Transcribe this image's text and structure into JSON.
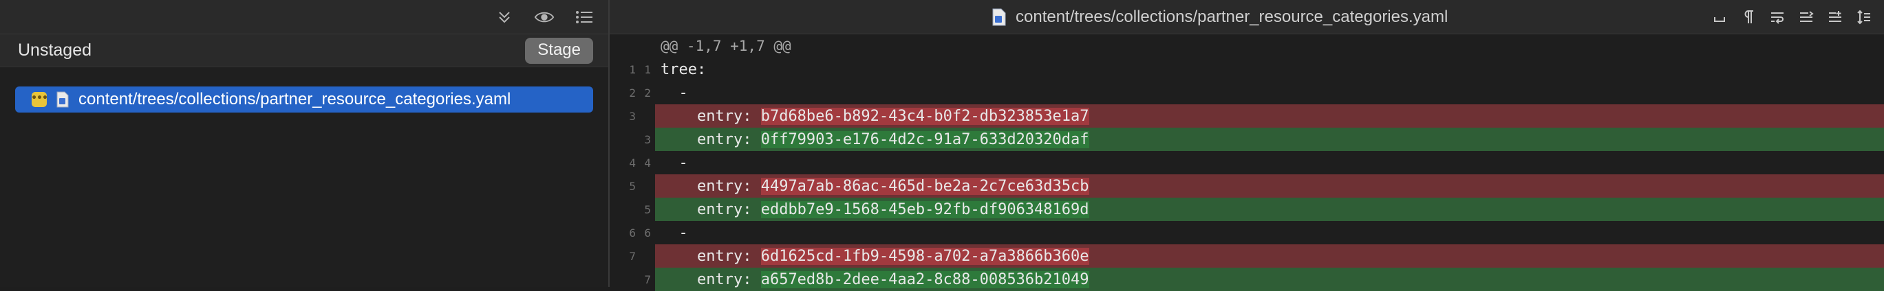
{
  "left": {
    "section_title": "Unstaged",
    "stage_label": "Stage",
    "files": [
      {
        "name": "content/trees/collections/partner_resource_categories.yaml",
        "status": "modified"
      }
    ]
  },
  "diff": {
    "title": "content/trees/collections/partner_resource_categories.yaml",
    "lines": [
      {
        "type": "hunk",
        "old": "",
        "new": "",
        "text": "@@ -1,7 +1,7 @@"
      },
      {
        "type": "context",
        "old": "1",
        "new": "1",
        "text": "tree:"
      },
      {
        "type": "context",
        "old": "2",
        "new": "2",
        "text": "  -"
      },
      {
        "type": "removed",
        "old": "3",
        "new": "",
        "prefix": "    entry: ",
        "value": "b7d68be6-b892-43c4-b0f2-db323853e1a7"
      },
      {
        "type": "added",
        "old": "",
        "new": "3",
        "prefix": "    entry: ",
        "value": "0ff79903-e176-4d2c-91a7-633d20320daf"
      },
      {
        "type": "context",
        "old": "4",
        "new": "4",
        "text": "  -"
      },
      {
        "type": "removed",
        "old": "5",
        "new": "",
        "prefix": "    entry: ",
        "value": "4497a7ab-86ac-465d-be2a-2c7ce63d35cb"
      },
      {
        "type": "added",
        "old": "",
        "new": "5",
        "prefix": "    entry: ",
        "value": "eddbb7e9-1568-45eb-92fb-df906348169d"
      },
      {
        "type": "context",
        "old": "6",
        "new": "6",
        "text": "  -"
      },
      {
        "type": "removed",
        "old": "7",
        "new": "",
        "prefix": "    entry: ",
        "value": "6d1625cd-1fb9-4598-a702-a7a3866b360e"
      },
      {
        "type": "added",
        "old": "",
        "new": "7",
        "prefix": "    entry: ",
        "value": "a657ed8b-2dee-4aa2-8c88-008536b21049"
      }
    ]
  },
  "colors": {
    "selection": "#2563c6",
    "removed_bg": "#6e3134",
    "removed_highlight": "#a23a3f",
    "added_bg": "#2f5e36",
    "added_highlight": "#2e7a3b",
    "modified_badge": "#e8c43a"
  },
  "icons": {
    "left_toolbar": [
      "chevron-double-down-icon",
      "eye-icon",
      "list-icon"
    ],
    "diff_toolbar": [
      "whitespace-icon",
      "pilcrow-icon",
      "wrap-icon",
      "collapse-icon",
      "expand-lines-icon",
      "expand-all-icon"
    ],
    "file": "document-icon"
  }
}
